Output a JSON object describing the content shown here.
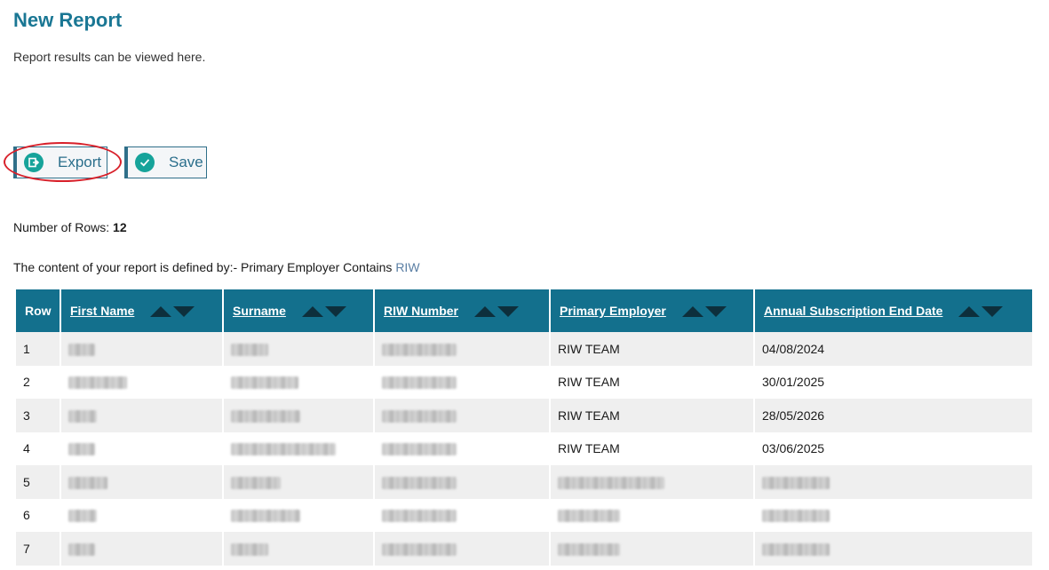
{
  "page": {
    "title": "New Report",
    "subtitle": "Report results can be viewed here."
  },
  "toolbar": {
    "export_label": "Export",
    "save_label": "Save"
  },
  "summary": {
    "rows_label": "Number of Rows:",
    "rows_count": "12",
    "definition_text": "The content of your report is defined by:- Primary Employer Contains",
    "definition_value": "RIW"
  },
  "table": {
    "headers": [
      "Row",
      "First Name",
      "Surname",
      "RIW Number",
      "Primary Employer",
      "Annual Subscription End Date"
    ],
    "rows": [
      {
        "row": "1",
        "employer": "RIW TEAM",
        "end_date": "04/08/2024"
      },
      {
        "row": "2",
        "employer": "RIW TEAM",
        "end_date": "30/01/2025"
      },
      {
        "row": "3",
        "employer": "RIW TEAM",
        "end_date": "28/05/2026"
      },
      {
        "row": "4",
        "employer": "RIW TEAM",
        "end_date": "03/06/2025"
      },
      {
        "row": "5",
        "employer": "",
        "end_date": ""
      },
      {
        "row": "6",
        "employer": "",
        "end_date": ""
      },
      {
        "row": "7",
        "employer": "",
        "end_date": ""
      }
    ]
  },
  "icons": {
    "export": "export-icon",
    "save": "check-circle-icon",
    "sort": "sort-arrows-icon"
  },
  "colors": {
    "accent": "#13708d",
    "title": "#1a7794",
    "icon": "#16a39a",
    "highlight": "#d8202a"
  }
}
